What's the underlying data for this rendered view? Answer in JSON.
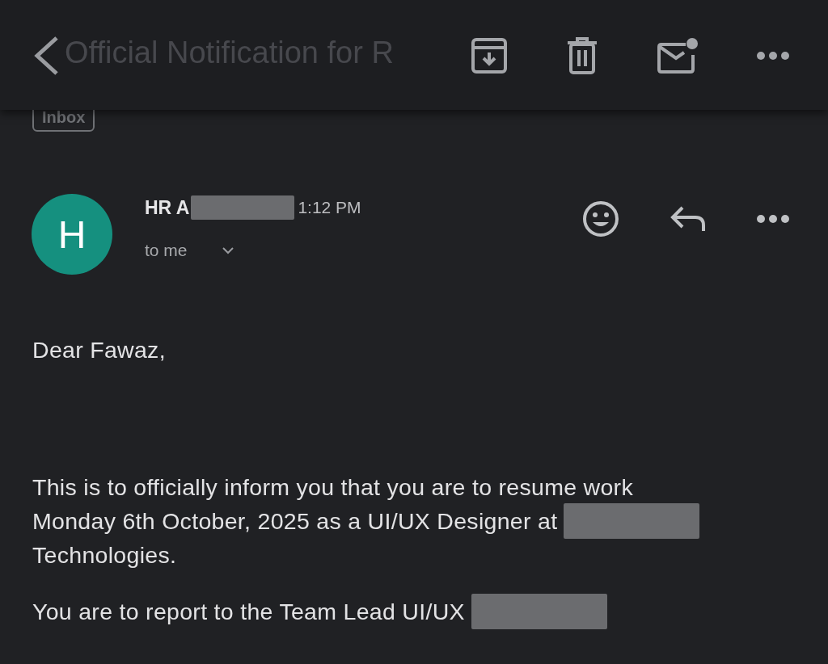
{
  "toolbar": {
    "title": "Official Notification for R"
  },
  "label": "Inbox",
  "message": {
    "avatar": "H",
    "color": "#15907f",
    "sender": "HR A",
    "time": "1:12 PM",
    "recipient": "to me"
  },
  "body": [
    [
      [
        {
          "kind": "text",
          "text": "Dear Fawaz,"
        }
      ]
    ],
    [
      [
        {
          "kind": "text",
          "text": "This is to officially inform you that you are to resume work"
        }
      ],
      [
        {
          "kind": "text",
          "text": "Monday 6th October, 2025 as a UI/UX Designer at"
        },
        {
          "kind": "redacted"
        }
      ],
      [
        {
          "kind": "text",
          "text": "Technologies."
        }
      ]
    ],
    [
      [
        {
          "kind": "text",
          "text": "You are to report to the Team Lead UI/UX"
        },
        {
          "kind": "redacted"
        }
      ]
    ]
  ]
}
